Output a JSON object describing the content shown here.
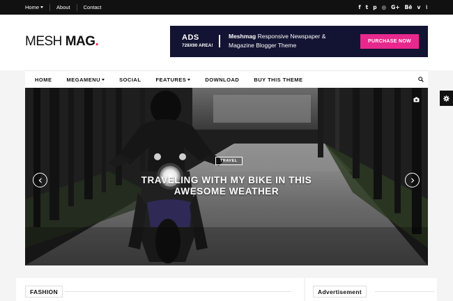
{
  "topbar": {
    "links": [
      "Home",
      "About",
      "Contact"
    ],
    "social_icons": [
      "facebook-icon",
      "twitter-icon",
      "pinterest-icon",
      "instagram-icon",
      "google-plus-icon",
      "behance-icon",
      "vimeo-icon",
      "rss-icon"
    ],
    "social_glyphs": [
      "f",
      "t",
      "p",
      "◎",
      "G+",
      "Bē",
      "v",
      "⌇"
    ]
  },
  "header": {
    "logo_part1": "MESH",
    "logo_part2": "MAG",
    "logo_dot": ".",
    "ad": {
      "title": "ADS",
      "size": "728X90 AREA!",
      "line1_bold": "Meshmag",
      "line1_rest": "Responsive Newspaper &",
      "line2_bold": "Magazine",
      "line2_rest": "Blogger Theme",
      "button": "PURCHASE NOW"
    }
  },
  "nav": {
    "items": [
      "HOME",
      "MEGAMENU",
      "SOCIAL",
      "FEATURES",
      "DOWNLOAD",
      "BUY THIS THEME"
    ]
  },
  "hero": {
    "category": "TRAVEL",
    "headline": "TRAVELING WITH MY BIKE IN THIS AWESOME WEATHER"
  },
  "sections": {
    "left_title": "FASHION",
    "right_title": "Advertisement"
  },
  "colors": {
    "accent": "#e8244a",
    "ad_bg": "#131333",
    "ad_button": "#e8288d",
    "topbar": "#111111"
  }
}
